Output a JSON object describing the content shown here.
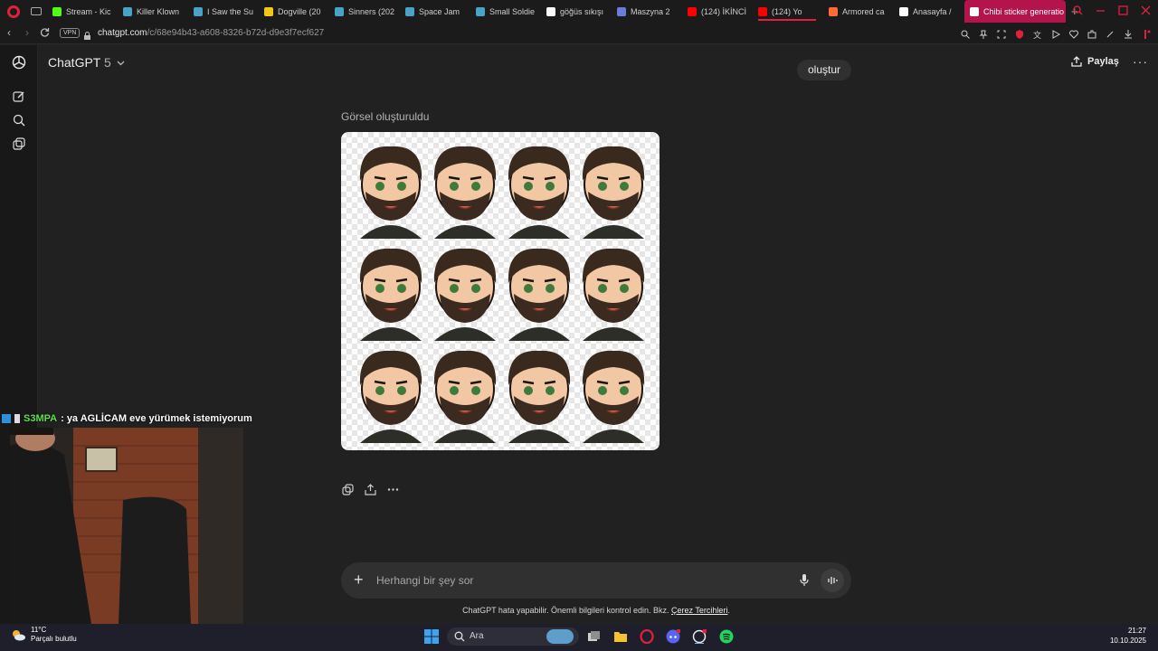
{
  "browser": {
    "tabs": [
      {
        "title": "Stream - Kic",
        "color": "#53fc18"
      },
      {
        "title": "Killer Klown",
        "color": "#4aa3c7"
      },
      {
        "title": "I Saw the Su",
        "color": "#4aa3c7"
      },
      {
        "title": "Dogville (20",
        "color": "#f5c518"
      },
      {
        "title": "Sinners (202",
        "color": "#4aa3c7"
      },
      {
        "title": "Space Jam",
        "color": "#4aa3c7"
      },
      {
        "title": "Small Soldie",
        "color": "#4aa3c7"
      },
      {
        "title": "göğüs sıkışı",
        "color": "#ffffff"
      },
      {
        "title": "Maszyna 2",
        "color": "#6b7cd6"
      },
      {
        "title": "(124) İKİNCİ",
        "color": "#ff0000"
      },
      {
        "title": "(124) Yo",
        "color": "#ff0000"
      },
      {
        "title": "Armored ca",
        "color": "#ff6b35"
      },
      {
        "title": "Anasayfa / ",
        "color": "#ffffff"
      },
      {
        "title": "Chibi sticker generatio",
        "color": "#ffffff"
      }
    ],
    "new_tab": "+",
    "vpn": "VPN",
    "url_host": "chatgpt.com",
    "url_path": "/c/68e94b43-a608-8326-b72d-d9e3f7ecf627"
  },
  "app": {
    "model_name": "ChatGPT",
    "model_version": "5",
    "share_label": "Paylaş",
    "user_message": "oluştur",
    "generated_label": "Görsel oluşturuldu",
    "image_alt": "Chibi sticker sheet",
    "composer_placeholder": "Herhangi bir şey sor",
    "disclaimer_text": "ChatGPT hata yapabilir. Önemli bilgileri kontrol edin. Bkz.",
    "disclaimer_link": "Çerez Tercihleri",
    "disclaimer_end": "."
  },
  "stream": {
    "chat_user": "S3MPA",
    "chat_message": ": ya AGLİCAM eve yürümek istemiyorum"
  },
  "taskbar": {
    "temperature": "11°C",
    "weather": "Parçalı bulutlu",
    "search_label": "Ara",
    "time": "21:27",
    "date": "10.10.2025"
  },
  "colors": {
    "accent": "#b4144c",
    "opera_red": "#e0213e",
    "chat_user": "#5fe04d"
  }
}
